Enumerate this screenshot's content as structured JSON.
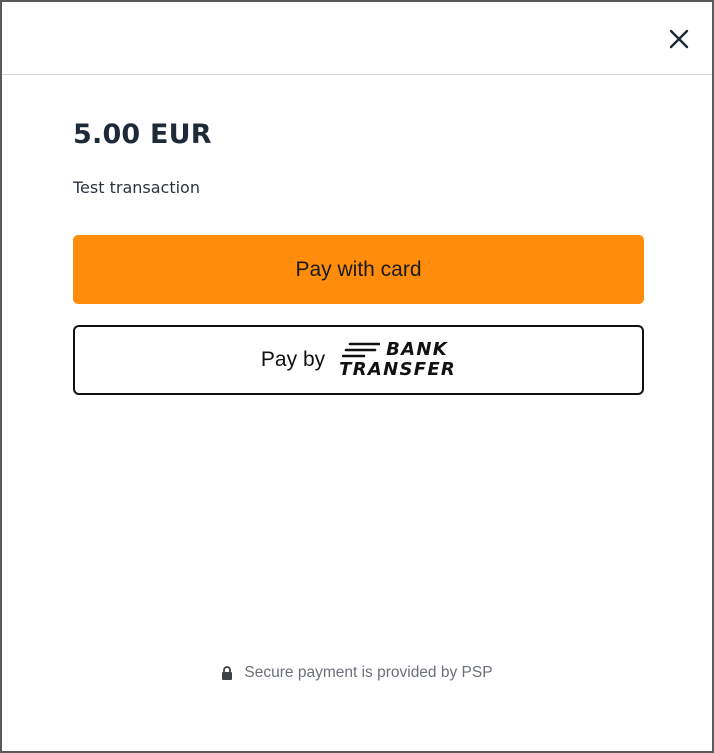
{
  "dialog": {
    "close_icon": "close-icon"
  },
  "payment": {
    "amount": "5.00 EUR",
    "description": "Test transaction"
  },
  "buttons": {
    "pay_card_label": "Pay with card",
    "pay_by_label": "Pay by",
    "bank_logo_line1": "BANK",
    "bank_logo_line2": "TRANSFER"
  },
  "footer": {
    "lock_icon": "lock-icon",
    "text": "Secure payment is provided by PSP"
  },
  "colors": {
    "accent": "#ff8c0a",
    "heading": "#1f2a38",
    "footer_text": "#6b7077"
  }
}
